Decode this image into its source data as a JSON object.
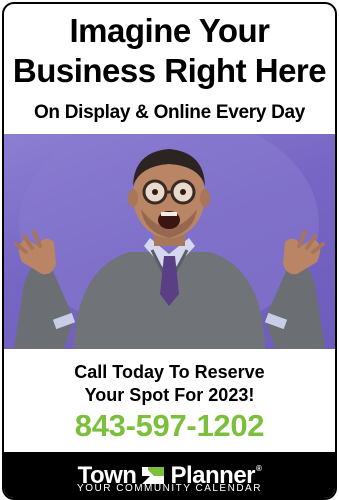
{
  "headline": {
    "line1": "Imagine Your",
    "line2": "Business Right Here",
    "line3": "On Display & Online Every Day"
  },
  "cta": {
    "line1": "Call Today To Reserve",
    "line2": "Your Spot For 2023!",
    "phone": "843-597-1202",
    "phone_color": "#7cbf3d"
  },
  "footer": {
    "brand_left": "Town",
    "brand_right": "Planner",
    "registered_mark": "®",
    "tagline": "YOUR COMMUNITY CALENDAR",
    "logo_icon": "calendar-flag-icon"
  },
  "photo": {
    "background_color": "#7766c4",
    "icon": "excited-man-photo"
  }
}
